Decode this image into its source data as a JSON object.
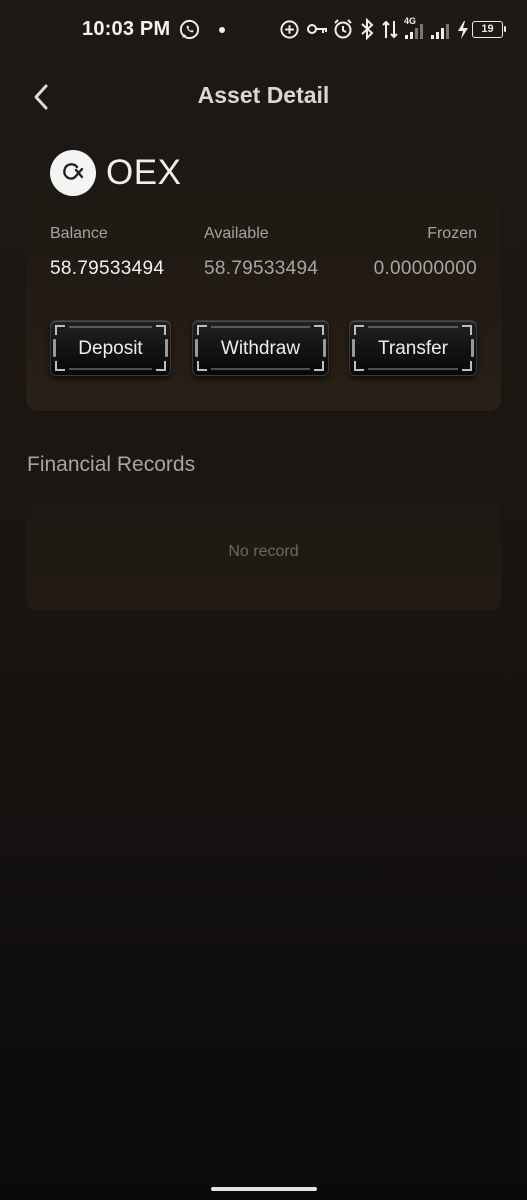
{
  "status_bar": {
    "time": "10:03 PM",
    "network_badge": "4G",
    "battery_level": "19",
    "icons": [
      "whatsapp-icon",
      "dot-icon",
      "add-circle-icon",
      "key-icon",
      "alarm-icon",
      "bluetooth-icon",
      "data-arrows-icon",
      "signal-icon",
      "signal-icon",
      "charging-icon",
      "battery-icon"
    ]
  },
  "header": {
    "title": "Asset Detail",
    "back_icon": "chevron-left-icon"
  },
  "asset": {
    "symbol": "OEX",
    "logo_icon": "oex-logo-icon",
    "balance_label": "Balance",
    "balance_value": "58.79533494",
    "available_label": "Available",
    "available_value": "58.79533494",
    "frozen_label": "Frozen",
    "frozen_value": "0.00000000"
  },
  "actions": {
    "deposit": "Deposit",
    "withdraw": "Withdraw",
    "transfer": "Transfer"
  },
  "records": {
    "title": "Financial Records",
    "empty_text": "No record"
  },
  "colors": {
    "background_top": "#1e1915",
    "background_bottom": "#0b0a0a",
    "card": "#2a2017",
    "label_text": "#a7a29d",
    "value_text": "#efefef",
    "muted_value": "#a9a49f"
  }
}
